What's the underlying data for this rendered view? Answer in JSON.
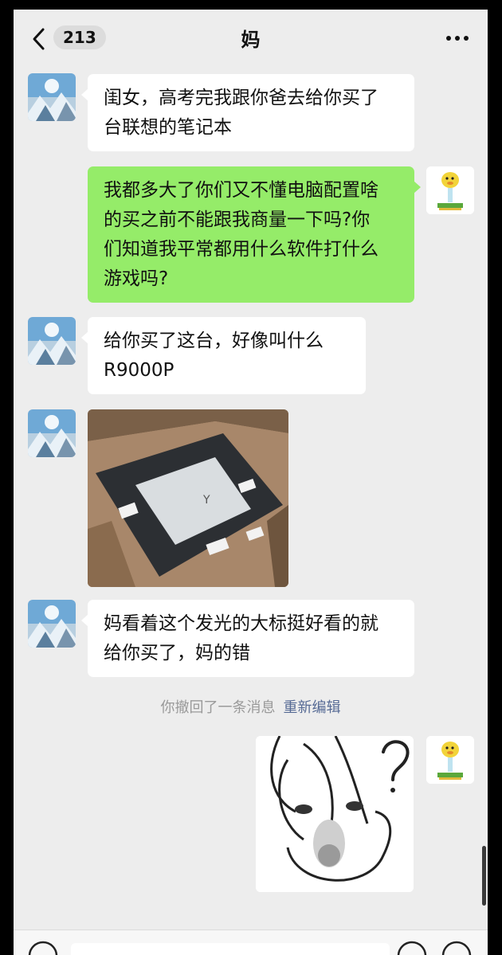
{
  "header": {
    "back_label": "<",
    "unread_count": "213",
    "title": "妈",
    "more_label": "···"
  },
  "messages": [
    {
      "from": "mom",
      "type": "text",
      "text": "闺女，高考完我跟你爸去给你买了\n台联想的笔记本"
    },
    {
      "from": "me",
      "type": "text",
      "text": "我都多大了你们又不懂电脑配置啥\n的买之前不能跟我商量一下吗?你\n们知道我平常都用什么软件打什么\n游戏吗?"
    },
    {
      "from": "mom",
      "type": "text",
      "text": "给你买了这台，好像叫什么\nR9000P"
    },
    {
      "from": "mom",
      "type": "image",
      "image": "laptop-box-photo"
    },
    {
      "from": "mom",
      "type": "text",
      "text": "妈看着这个发光的大标挺好看的就\n给你买了，妈的错"
    },
    {
      "from": "me",
      "type": "sticker",
      "image": "confused-rabbit-sticker"
    }
  ],
  "system_notice": {
    "text": "你撤回了一条消息",
    "action": "重新编辑"
  },
  "colors": {
    "background": "#ededed",
    "incoming_bubble": "#ffffff",
    "outgoing_bubble": "#95ec69",
    "link": "#576b95"
  }
}
